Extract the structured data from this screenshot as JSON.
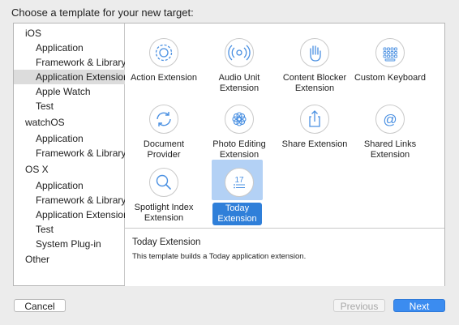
{
  "dialog": {
    "prompt": "Choose a template for your new target:"
  },
  "sidebar": {
    "rows": [
      {
        "type": "platform",
        "label": "iOS"
      },
      {
        "type": "item",
        "label": "Application"
      },
      {
        "type": "item",
        "label": "Framework & Library"
      },
      {
        "type": "item",
        "label": "Application Extension",
        "selected": true
      },
      {
        "type": "item",
        "label": "Apple Watch"
      },
      {
        "type": "item",
        "label": "Test"
      },
      {
        "type": "platform",
        "label": "watchOS"
      },
      {
        "type": "item",
        "label": "Application"
      },
      {
        "type": "item",
        "label": "Framework & Library"
      },
      {
        "type": "platform",
        "label": "OS X"
      },
      {
        "type": "item",
        "label": "Application"
      },
      {
        "type": "item",
        "label": "Framework & Library"
      },
      {
        "type": "item",
        "label": "Application Extension"
      },
      {
        "type": "item",
        "label": "Test"
      },
      {
        "type": "item",
        "label": "System Plug-in"
      },
      {
        "type": "platform",
        "label": "Other"
      }
    ]
  },
  "templates": [
    {
      "label": "Action Extension",
      "icon": "gear-icon"
    },
    {
      "label": "Audio Unit Extension",
      "icon": "audio-unit-icon"
    },
    {
      "label": "Content Blocker Extension",
      "icon": "hand-icon"
    },
    {
      "label": "Custom Keyboard",
      "icon": "keyboard-icon"
    },
    {
      "label": "Document Provider",
      "icon": "sync-icon"
    },
    {
      "label": "Photo Editing Extension",
      "icon": "flower-icon"
    },
    {
      "label": "Share Extension",
      "icon": "share-icon"
    },
    {
      "label": "Shared Links Extension",
      "icon": "at-sign-icon"
    },
    {
      "label": "Spotlight Index Extension",
      "icon": "magnifier-icon"
    },
    {
      "label": "Today Extension",
      "icon": "today-calendar-icon",
      "selected": true,
      "badge": "17"
    }
  ],
  "description": {
    "title": "Today Extension",
    "text": "This template builds a Today application extension."
  },
  "buttons": {
    "cancel": "Cancel",
    "previous": "Previous",
    "next": "Next"
  },
  "colors": {
    "accent": "#3b8cf0",
    "selection": "#2f7fd9",
    "icon_stroke": "#4a90e2"
  }
}
